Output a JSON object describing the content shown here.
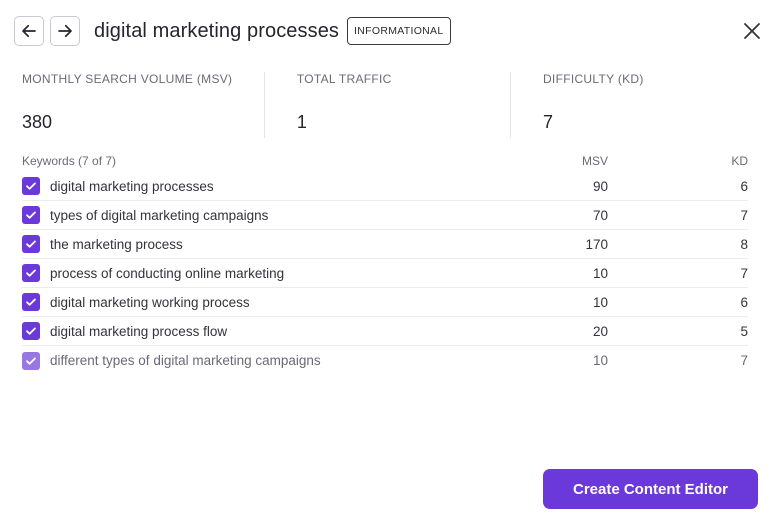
{
  "header": {
    "title": "digital marketing processes",
    "intent": "INFORMATIONAL",
    "icons": {
      "back": "arrow-left-icon",
      "forward": "arrow-right-icon",
      "close": "close-icon"
    }
  },
  "metrics": [
    {
      "label": "MONTHLY SEARCH VOLUME (MSV)",
      "value": "380"
    },
    {
      "label": "TOTAL TRAFFIC",
      "value": "1"
    },
    {
      "label": "DIFFICULTY (KD)",
      "value": "7"
    }
  ],
  "table": {
    "headers": {
      "keyword": "Keywords (7 of 7)",
      "msv": "MSV",
      "kd": "KD"
    },
    "rows": [
      {
        "keyword": "digital marketing processes",
        "msv": "90",
        "kd": "6",
        "checked": true
      },
      {
        "keyword": "types of digital marketing campaigns",
        "msv": "70",
        "kd": "7",
        "checked": true
      },
      {
        "keyword": "the marketing process",
        "msv": "170",
        "kd": "8",
        "checked": true
      },
      {
        "keyword": "process of conducting online marketing",
        "msv": "10",
        "kd": "7",
        "checked": true
      },
      {
        "keyword": "digital marketing working process",
        "msv": "10",
        "kd": "6",
        "checked": true
      },
      {
        "keyword": "digital marketing process flow",
        "msv": "20",
        "kd": "5",
        "checked": true
      },
      {
        "keyword": "different types of digital marketing campaigns",
        "msv": "10",
        "kd": "7",
        "checked": true
      }
    ]
  },
  "cta": {
    "label": "Create Content Editor"
  },
  "colors": {
    "accent": "#6b38d9",
    "accent_faded": "#9877e3",
    "border": "#e4e4ea"
  }
}
